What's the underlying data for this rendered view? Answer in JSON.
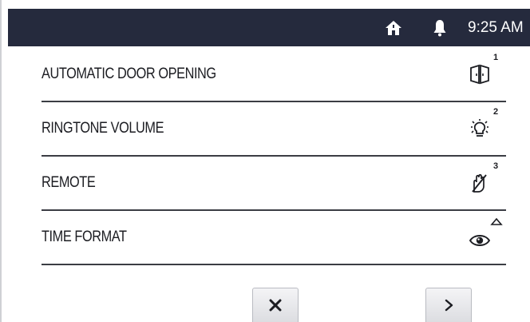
{
  "status_bar": {
    "time": "9:25 AM",
    "icons": [
      "home-icon",
      "bell-icon"
    ]
  },
  "menu": {
    "items": [
      {
        "label": "AUTOMATIC DOOR OPENING",
        "icon": "door-icon",
        "badge": "1"
      },
      {
        "label": "RINGTONE VOLUME",
        "icon": "light-bulb-icon",
        "badge": "2"
      },
      {
        "label": "REMOTE",
        "icon": "no-hand-icon",
        "badge": "3"
      },
      {
        "label": "TIME FORMAT",
        "icon": "eye-icon",
        "badge_icon": "triangle-up-icon"
      }
    ]
  },
  "footer": {
    "buttons": [
      {
        "icon": "close-icon"
      },
      {
        "icon": "chevron-right-icon"
      }
    ]
  },
  "colors": {
    "status_bar_bg": "#252a3d",
    "text": "#1c1d22",
    "divider": "#3b3d44"
  }
}
